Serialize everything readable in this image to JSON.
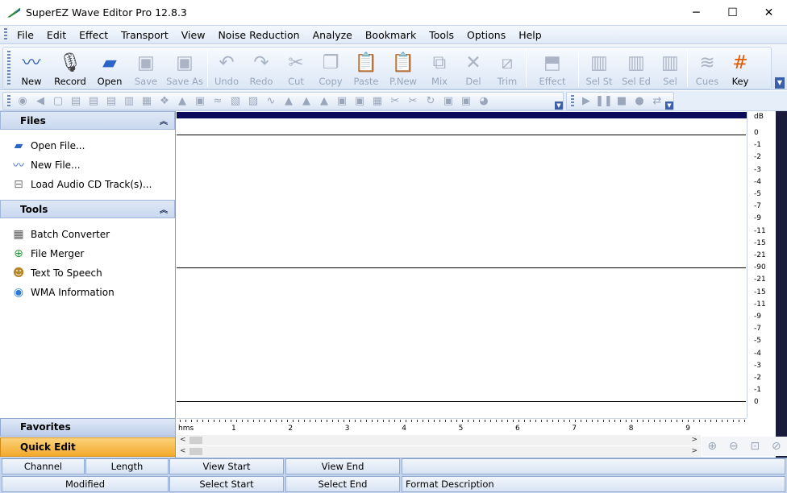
{
  "window": {
    "title": "SuperEZ Wave Editor Pro 12.8.3",
    "controls": [
      "─",
      "☐",
      "✕"
    ]
  },
  "menu": [
    "File",
    "Edit",
    "Effect",
    "Transport",
    "View",
    "Noise Reduction",
    "Analyze",
    "Bookmark",
    "Tools",
    "Options",
    "Help"
  ],
  "toolbar": {
    "buttons": [
      {
        "label": "New",
        "icon": "new-wave-icon",
        "enabled": true
      },
      {
        "label": "Record",
        "icon": "microphone-icon",
        "enabled": true
      },
      {
        "label": "Open",
        "icon": "open-folder-icon",
        "enabled": true
      },
      {
        "label": "Save",
        "icon": "save-icon",
        "enabled": false
      },
      {
        "label": "Save As",
        "icon": "save-as-icon",
        "enabled": false
      },
      {
        "label": "Undo",
        "icon": "undo-icon",
        "enabled": false
      },
      {
        "label": "Redo",
        "icon": "redo-icon",
        "enabled": false
      },
      {
        "label": "Cut",
        "icon": "cut-icon",
        "enabled": false
      },
      {
        "label": "Copy",
        "icon": "copy-icon",
        "enabled": false
      },
      {
        "label": "Paste",
        "icon": "paste-icon",
        "enabled": false
      },
      {
        "label": "P.New",
        "icon": "paste-new-icon",
        "enabled": false
      },
      {
        "label": "Mix",
        "icon": "mix-icon",
        "enabled": false
      },
      {
        "label": "Del",
        "icon": "delete-icon",
        "enabled": false
      },
      {
        "label": "Trim",
        "icon": "trim-icon",
        "enabled": false
      },
      {
        "label": "Effect",
        "icon": "effect-icon",
        "enabled": false
      },
      {
        "label": "Sel St",
        "icon": "select-start-icon",
        "enabled": false
      },
      {
        "label": "Sel Ed",
        "icon": "select-end-icon",
        "enabled": false
      },
      {
        "label": "Sel",
        "icon": "select-icon",
        "enabled": false
      },
      {
        "label": "Cues",
        "icon": "cues-icon",
        "enabled": false
      },
      {
        "label": "Key",
        "icon": "key-icon",
        "enabled": true
      }
    ]
  },
  "files_panel": {
    "title": "Files",
    "items": [
      {
        "label": "Open File...",
        "icon": "open-file-icon"
      },
      {
        "label": "New File...",
        "icon": "new-file-icon"
      },
      {
        "label": "Load Audio CD Track(s)...",
        "icon": "cd-drive-icon"
      }
    ]
  },
  "tools_panel": {
    "title": "Tools",
    "items": [
      {
        "label": "Batch Converter",
        "icon": "batch-converter-icon"
      },
      {
        "label": "File Merger",
        "icon": "file-merger-icon"
      },
      {
        "label": "Text To Speech",
        "icon": "text-to-speech-icon"
      },
      {
        "label": "WMA Information",
        "icon": "wma-info-icon"
      }
    ]
  },
  "favorites_label": "Favorites",
  "quickedit_label": "Quick Edit",
  "db_scale": {
    "unit": "dB",
    "labels": [
      "0",
      "-1",
      "-2",
      "-3",
      "-4",
      "-5",
      "-7",
      "-9",
      "-11",
      "-15",
      "-21",
      "-90",
      "-21",
      "-15",
      "-11",
      "-9",
      "-7",
      "-5",
      "-4",
      "-3",
      "-2",
      "-1",
      "0"
    ]
  },
  "ruler": {
    "unit": "hms",
    "labels": [
      "1",
      "2",
      "3",
      "4",
      "5",
      "6",
      "7",
      "8",
      "9"
    ]
  },
  "status": {
    "row1": [
      "Channel",
      "Length",
      "View Start",
      "View End",
      ""
    ],
    "row2": [
      "Modified",
      "Select Start",
      "Select End",
      "Format Description"
    ]
  }
}
